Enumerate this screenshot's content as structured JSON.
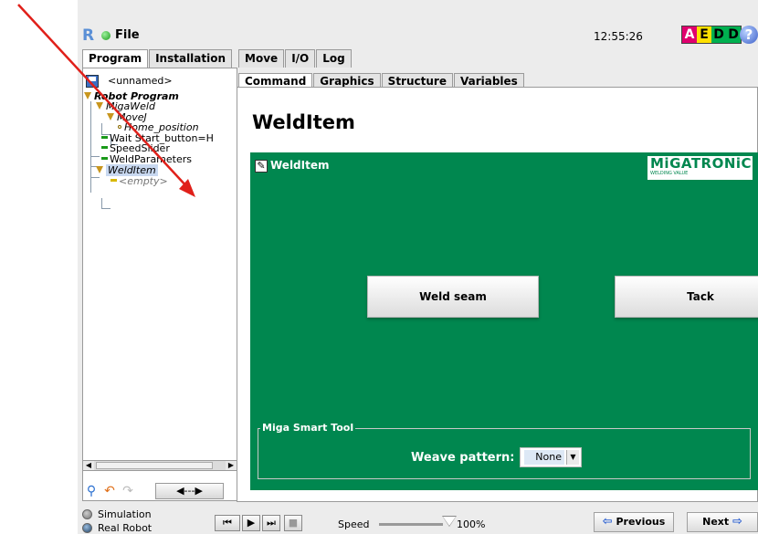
{
  "header": {
    "file_label": "File",
    "clock": "12:55:26",
    "status_letters": [
      "A",
      "E",
      "D",
      "D"
    ],
    "help_glyph": "?"
  },
  "main_tabs": [
    {
      "label": "Program",
      "active": true
    },
    {
      "label": "Installation",
      "active": false
    },
    {
      "label": "Move",
      "active": false
    },
    {
      "label": "I/O",
      "active": false
    },
    {
      "label": "Log",
      "active": false
    }
  ],
  "left": {
    "program_name": "<unnamed>",
    "tree": {
      "root": "Robot Program",
      "migaweld": "MigaWeld",
      "movej": "MoveJ",
      "home": "Home_position",
      "wait": "Wait Start_button=H",
      "speed": "SpeedSlider",
      "weldparams": "WeldParameters",
      "welditem": "WeldItem",
      "empty": "<empty>"
    },
    "arrow_button": "◀---▶"
  },
  "sub_tabs": [
    {
      "label": "Command",
      "active": true
    },
    {
      "label": "Graphics",
      "active": false
    },
    {
      "label": "Structure",
      "active": false
    },
    {
      "label": "Variables",
      "active": false
    }
  ],
  "command": {
    "title": "WeldItem",
    "panel_label": "WeldItem",
    "logo_main": "MiGATRONiC",
    "logo_sub": "WELDING VALUE",
    "weld_seam_button": "Weld seam",
    "tack_button": "Tack",
    "group_title": "Miga Smart Tool",
    "weave_label": "Weave pattern:",
    "weave_value": "None"
  },
  "bottom": {
    "simulation": "Simulation",
    "real_robot": "Real Robot",
    "speed_label": "Speed",
    "speed_value": "100%",
    "speed_fraction": 1.0,
    "previous": "Previous",
    "next": "Next"
  },
  "colors": {
    "panel_green": "#00874f",
    "annotation_arrow": "#e0201a"
  }
}
